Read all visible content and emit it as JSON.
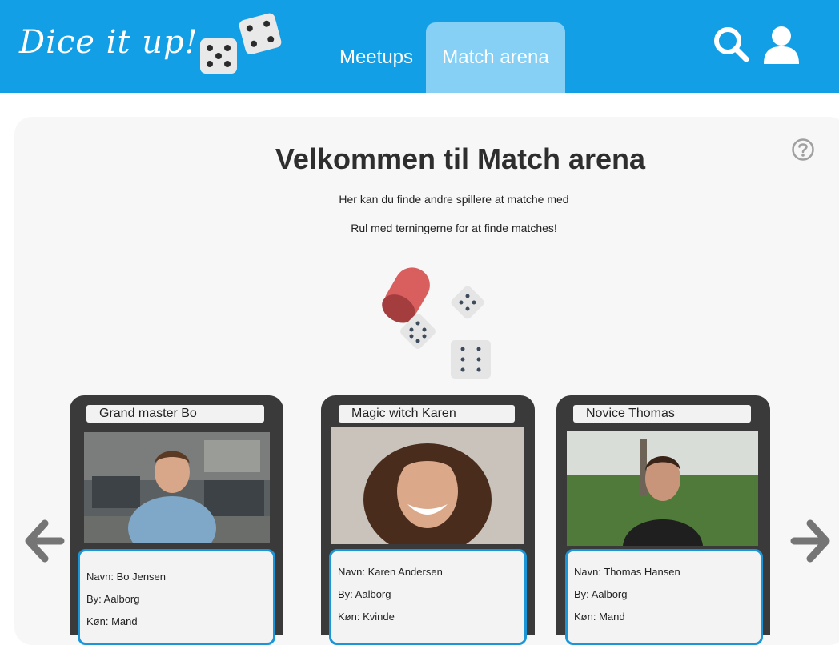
{
  "header": {
    "logo_text": "Dice it up!",
    "nav": [
      {
        "label": "Meetups"
      },
      {
        "label": "Match arena",
        "active": true
      }
    ],
    "icons": [
      "search-icon",
      "user-icon"
    ]
  },
  "main": {
    "title": "Velkommen til Match arena",
    "subtitle1": "Her kan du finde andre spillere at matche med",
    "subtitle2": "Rul med terningerne for at finde matches!",
    "help_icon": "help-icon"
  },
  "cards": [
    {
      "title": "Grand master Bo",
      "name": "Navn: Bo Jensen",
      "city": "By: Aalborg",
      "gender": "Køn: Mand"
    },
    {
      "title": "Magic witch Karen",
      "name": "Navn: Karen Andersen",
      "city": "By: Aalborg",
      "gender": "Køn: Kvinde"
    },
    {
      "title": "Novice Thomas",
      "name": "Navn: Thomas Hansen",
      "city": "By: Aalborg",
      "gender": "Køn: Mand"
    }
  ],
  "colors": {
    "header": "#129fe6",
    "active_tab": "#86cff5",
    "card_border": "#1a96d8"
  }
}
